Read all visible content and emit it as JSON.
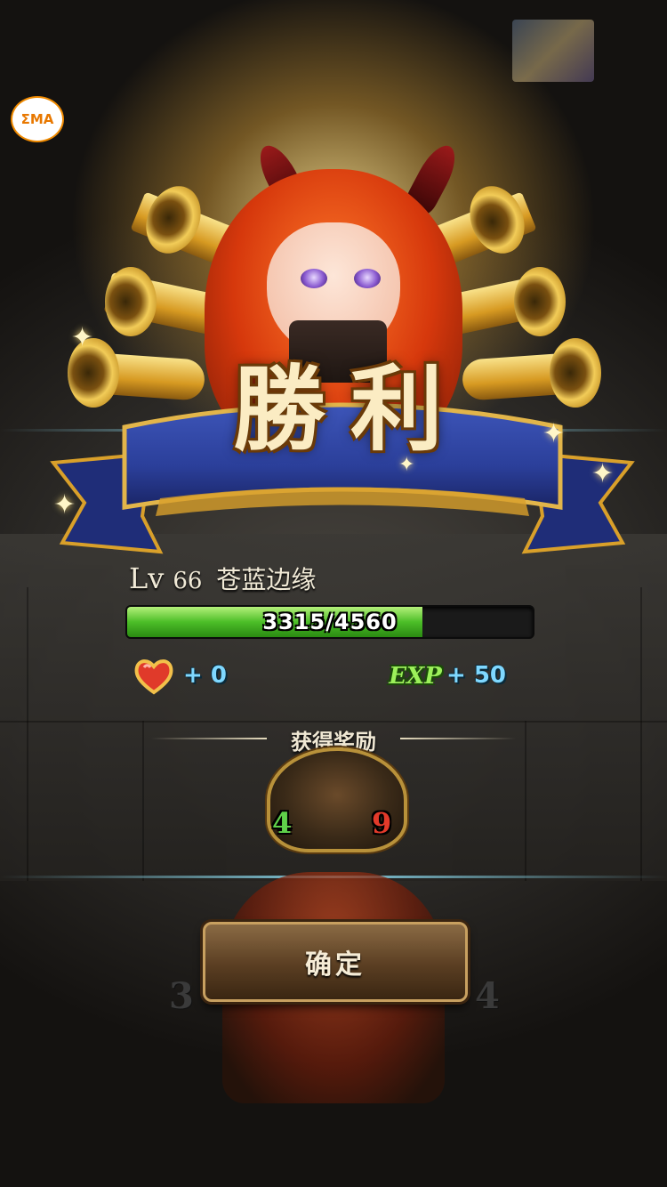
{
  "header": {
    "emblem_text": "ΣMA"
  },
  "victory": {
    "title_char_1": "勝",
    "title_char_2": "利"
  },
  "character": {
    "level_label": "Lv",
    "level": "66",
    "name": "苍蓝边缘",
    "exp_current": 3315,
    "exp_max": 4560,
    "exp_text": "3315/4560"
  },
  "gains": {
    "affection_icon": "heart-icon",
    "affection_bonus": "+ 0",
    "exp_icon_text": "EXP",
    "exp_bonus": "+ 50"
  },
  "reward": {
    "title": "获得奖励",
    "card_left_stat": "4",
    "card_right_stat": "9"
  },
  "background_cards": {
    "left_stat": "3",
    "right_stat": "4"
  },
  "actions": {
    "confirm_label": "确定"
  },
  "colors": {
    "ribbon_blue": "#2b3f9a",
    "gold": "#d9a02a",
    "exp_green": "#4cbe28",
    "bonus_cyan": "#7fd8ff",
    "stat_green": "#5fd04a",
    "stat_red": "#e23a2a"
  }
}
